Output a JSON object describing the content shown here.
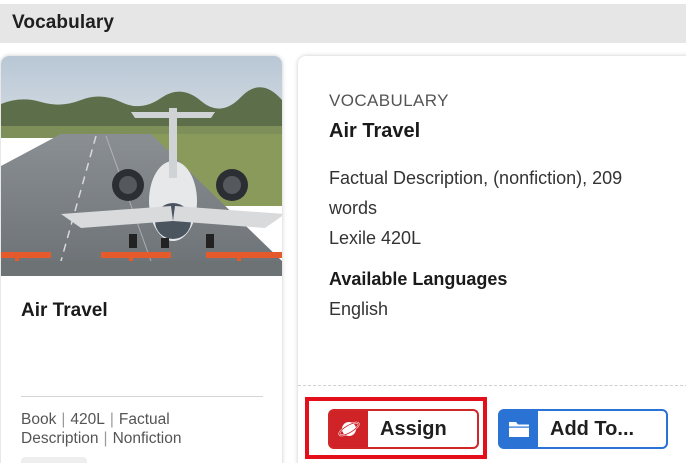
{
  "header": {
    "title": "Vocabulary"
  },
  "card": {
    "title": "Air Travel",
    "meta": {
      "type": "Book",
      "lexile": "420L",
      "genre_line1": "Factual",
      "genre_line2": "Description",
      "category": "Nonfiction"
    }
  },
  "detail": {
    "eyebrow": "VOCABULARY",
    "title": "Air Travel",
    "description_line1": "Factual Description, (nonfiction), 209",
    "description_line2": "words",
    "lexile": "Lexile 420L",
    "languages_heading": "Available Languages",
    "language": "English"
  },
  "actions": {
    "assign_label": "Assign",
    "add_to_label": "Add To..."
  },
  "colors": {
    "assign": "#cf2328",
    "add_to": "#2a72d4",
    "highlight": "#e3101c"
  }
}
